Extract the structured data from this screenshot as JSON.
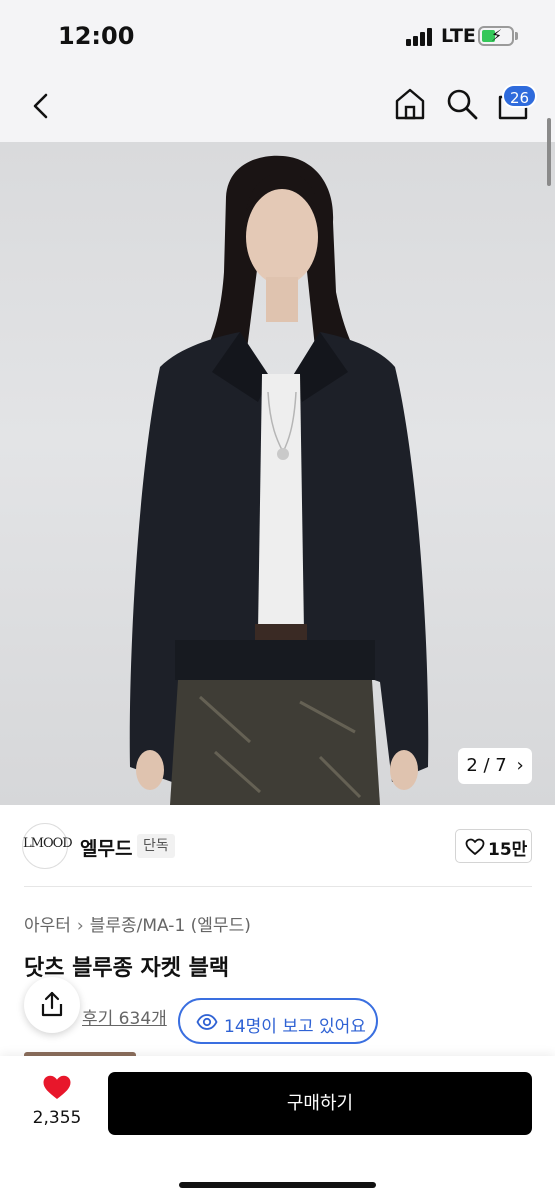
{
  "status_bar": {
    "time": "12:00",
    "network": "LTE",
    "icons": [
      "signal-icon",
      "battery-charging-icon"
    ]
  },
  "nav": {
    "icons": [
      "chevron-left-icon",
      "home-icon",
      "search-icon",
      "shopping-bag-icon"
    ],
    "cart_badge": "26"
  },
  "gallery": {
    "counter": "2 / 7",
    "counter_icon": "chevron-right-icon"
  },
  "brand": {
    "logo_text": "LMOOD",
    "name": "엘무드",
    "tag": "단독",
    "likes": "15만"
  },
  "product": {
    "breadcrumb": [
      "아우터",
      "블루종/MA-1 (엘무드)"
    ],
    "breadcrumb_icon": "chevron-right-icon",
    "title": "닷츠 블루종 자켓 블랙",
    "review_link": "후기 634개",
    "viewers": "14명이 보고 있어요"
  },
  "bottom_bar": {
    "wish_count": "2,355",
    "buy_label": "구매하기"
  },
  "colors": {
    "accent_blue": "#2f6bdc",
    "heart_red": "#e8172b",
    "buy_button": "#000000"
  }
}
